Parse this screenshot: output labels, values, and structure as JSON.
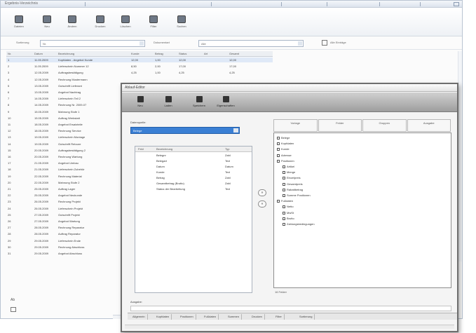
{
  "main": {
    "title": "Ergebnis-Verzeichnis",
    "toolbar": [
      {
        "label": "Dateien",
        "icon": "folder-icon"
      },
      {
        "label": "Neu",
        "icon": "new-icon"
      },
      {
        "label": "Ändern",
        "icon": "edit-icon"
      },
      {
        "label": "Drucken",
        "icon": "print-icon"
      },
      {
        "label": "Löschen",
        "icon": "delete-icon"
      },
      {
        "label": "Filter",
        "icon": "filter-icon"
      },
      {
        "label": "Suchen",
        "icon": "search-icon"
      }
    ],
    "filters": {
      "combo1_label": "Sortierung",
      "combo1_value": "Nr.",
      "combo2_label": "Dokumentart",
      "combo2_value": "Alle",
      "extra_label": "Alle Einträge"
    },
    "columns": [
      "Nr.",
      "Datum",
      "Bezeichnung",
      "Kunde",
      "Betrag",
      "Status",
      "Art",
      "Gesamt"
    ],
    "rows": [
      {
        "nr": "1",
        "date": "11.05.2009",
        "name": "Kopfdaten - Angebot Kunde",
        "v1": "12,00",
        "v2": "1,00",
        "v3": "12,00",
        "v4": "",
        "total": "12,00"
      },
      {
        "nr": "2",
        "date": "11.05.2009",
        "name": "Lieferschein Nummer 12",
        "v1": "8,50",
        "v2": "2,00",
        "v3": "17,00",
        "v4": "",
        "total": "17,00"
      },
      {
        "nr": "3",
        "date": "12.05.2009",
        "name": "Auftragsbestätigung",
        "v1": "4,25",
        "v2": "1,00",
        "v3": "4,25",
        "v4": "",
        "total": "4,25"
      },
      {
        "nr": "4",
        "date": "12.05.2009",
        "name": "Rechnung Mustermann",
        "v1": "",
        "v2": "",
        "v3": "",
        "v4": "",
        "total": ""
      },
      {
        "nr": "5",
        "date": "13.05.2009",
        "name": "Gutschrift Lieferant",
        "v1": "",
        "v2": "",
        "v3": "",
        "v4": "",
        "total": ""
      },
      {
        "nr": "6",
        "date": "13.05.2009",
        "name": "Angebot Nachtrag",
        "v1": "",
        "v2": "",
        "v3": "",
        "v4": "",
        "total": ""
      },
      {
        "nr": "7",
        "date": "14.05.2009",
        "name": "Lieferschein Teil 2",
        "v1": "",
        "v2": "",
        "v3": "",
        "v4": "",
        "total": ""
      },
      {
        "nr": "8",
        "date": "14.05.2009",
        "name": "Rechnung Nr. 2009-07",
        "v1": "",
        "v2": "",
        "v3": "",
        "v4": "",
        "total": ""
      },
      {
        "nr": "9",
        "date": "15.05.2009",
        "name": "Mahnung Stufe 1",
        "v1": "",
        "v2": "",
        "v3": "",
        "v4": "",
        "total": ""
      },
      {
        "nr": "10",
        "date": "15.05.2009",
        "name": "Auftrag Werkstatt",
        "v1": "",
        "v2": "",
        "v3": "",
        "v4": "",
        "total": ""
      },
      {
        "nr": "11",
        "date": "18.05.2009",
        "name": "Angebot Ersatzteile",
        "v1": "",
        "v2": "",
        "v3": "",
        "v4": "",
        "total": ""
      },
      {
        "nr": "12",
        "date": "18.05.2009",
        "name": "Rechnung Service",
        "v1": "",
        "v2": "",
        "v3": "",
        "v4": "",
        "total": ""
      },
      {
        "nr": "13",
        "date": "19.05.2009",
        "name": "Lieferschein Montage",
        "v1": "",
        "v2": "",
        "v3": "",
        "v4": "",
        "total": ""
      },
      {
        "nr": "14",
        "date": "19.05.2009",
        "name": "Gutschrift Retoure",
        "v1": "",
        "v2": "",
        "v3": "",
        "v4": "",
        "total": ""
      },
      {
        "nr": "15",
        "date": "20.05.2009",
        "name": "Auftragsbestätigung 2",
        "v1": "",
        "v2": "",
        "v3": "",
        "v4": "",
        "total": ""
      },
      {
        "nr": "16",
        "date": "20.05.2009",
        "name": "Rechnung Wartung",
        "v1": "",
        "v2": "",
        "v3": "",
        "v4": "",
        "total": ""
      },
      {
        "nr": "17",
        "date": "21.05.2009",
        "name": "Angebot Umbau",
        "v1": "",
        "v2": "",
        "v3": "",
        "v4": "",
        "total": ""
      },
      {
        "nr": "18",
        "date": "21.05.2009",
        "name": "Lieferschein Zubehör",
        "v1": "",
        "v2": "",
        "v3": "",
        "v4": "",
        "total": ""
      },
      {
        "nr": "19",
        "date": "22.05.2009",
        "name": "Rechnung Material",
        "v1": "",
        "v2": "",
        "v3": "",
        "v4": "",
        "total": ""
      },
      {
        "nr": "20",
        "date": "22.05.2009",
        "name": "Mahnung Stufe 2",
        "v1": "",
        "v2": "",
        "v3": "",
        "v4": "",
        "total": ""
      },
      {
        "nr": "21",
        "date": "25.05.2009",
        "name": "Auftrag Lager",
        "v1": "",
        "v2": "",
        "v3": "",
        "v4": "",
        "total": ""
      },
      {
        "nr": "22",
        "date": "25.05.2009",
        "name": "Angebot Neukunde",
        "v1": "",
        "v2": "",
        "v3": "",
        "v4": "",
        "total": ""
      },
      {
        "nr": "23",
        "date": "26.05.2009",
        "name": "Rechnung Projekt",
        "v1": "",
        "v2": "",
        "v3": "",
        "v4": "",
        "total": ""
      },
      {
        "nr": "24",
        "date": "26.05.2009",
        "name": "Lieferschein Projekt",
        "v1": "",
        "v2": "",
        "v3": "",
        "v4": "",
        "total": ""
      },
      {
        "nr": "25",
        "date": "27.05.2009",
        "name": "Gutschrift Projekt",
        "v1": "",
        "v2": "",
        "v3": "",
        "v4": "",
        "total": ""
      },
      {
        "nr": "26",
        "date": "27.05.2009",
        "name": "Angebot Wartung",
        "v1": "",
        "v2": "",
        "v3": "",
        "v4": "",
        "total": ""
      },
      {
        "nr": "27",
        "date": "28.05.2009",
        "name": "Rechnung Reparatur",
        "v1": "",
        "v2": "",
        "v3": "",
        "v4": "",
        "total": ""
      },
      {
        "nr": "28",
        "date": "28.05.2009",
        "name": "Auftrag Reparatur",
        "v1": "",
        "v2": "",
        "v3": "",
        "v4": "",
        "total": ""
      },
      {
        "nr": "29",
        "date": "29.05.2009",
        "name": "Lieferschein Ende",
        "v1": "",
        "v2": "",
        "v3": "",
        "v4": "",
        "total": ""
      },
      {
        "nr": "30",
        "date": "29.05.2009",
        "name": "Rechnung Abschluss",
        "v1": "",
        "v2": "",
        "v3": "",
        "v4": "",
        "total": ""
      },
      {
        "nr": "31",
        "date": "29.05.2009",
        "name": "Angebot Abschluss",
        "v1": "",
        "v2": "",
        "v3": "",
        "v4": "",
        "total": ""
      }
    ],
    "status_text": "Ab"
  },
  "dialog": {
    "title": "Ablauf-Editor",
    "toolbar": [
      {
        "label": "Neu",
        "icon": "new-icon"
      },
      {
        "label": "Laden",
        "icon": "open-icon"
      },
      {
        "label": "Speichern",
        "icon": "save-icon"
      },
      {
        "label": "Eigenschaften",
        "icon": "properties-icon"
      }
    ],
    "source_label": "Datenquelle:",
    "source_value": "Belege",
    "field_columns": [
      "Feld",
      "Bezeichnung",
      "Typ"
    ],
    "fields": [
      {
        "f": "",
        "name": "Belegnr",
        "type": "Zahl"
      },
      {
        "f": "",
        "name": "Belegart",
        "type": "Text"
      },
      {
        "f": "",
        "name": "Datum",
        "type": "Datum"
      },
      {
        "f": "",
        "name": "Kunde",
        "type": "Text"
      },
      {
        "f": "",
        "name": "Betrag",
        "type": "Zahl"
      },
      {
        "f": "",
        "name": "Gesamtbetrag (Brutto)",
        "type": "Zahl"
      },
      {
        "f": "",
        "name": "Status der Bearbeitung",
        "type": "Text"
      }
    ],
    "move_right": "»",
    "move_left": "«",
    "tabs": [
      "Vorlage",
      "Felder",
      "Gruppen",
      "Ausgabe"
    ],
    "tree": [
      {
        "label": "Belege",
        "level": 0
      },
      {
        "label": "Kopfdaten",
        "level": 0
      },
      {
        "label": "Kunde",
        "level": 0
      },
      {
        "label": "Adresse",
        "level": 0
      },
      {
        "label": "Positionen",
        "level": 0
      },
      {
        "label": "Artikel",
        "level": 1
      },
      {
        "label": "Menge",
        "level": 1
      },
      {
        "label": "Einzelpreis",
        "level": 1
      },
      {
        "label": "Gesamtpreis",
        "level": 1
      },
      {
        "label": "Rabattbetrag",
        "level": 1
      },
      {
        "label": "Summe Positionen",
        "level": 1
      },
      {
        "label": "Fußdaten",
        "level": 0
      },
      {
        "label": "Netto",
        "level": 1
      },
      {
        "label": "MwSt",
        "level": 1
      },
      {
        "label": "Brutto",
        "level": 1
      },
      {
        "label": "Zahlungsbedingungen",
        "level": 1
      }
    ],
    "tree_status": "16 Felder",
    "bottom_label": "Ausgabe:",
    "bottom_tabs": [
      "Allgemein",
      "Kopfdaten",
      "Positionen",
      "Fußdaten",
      "Summen",
      "Drucken",
      "Filter",
      "Sortierung"
    ]
  },
  "colors": {
    "accent": "#3a7fd4",
    "dialog_toolbar": "#9e9e9e",
    "window_border": "#b9c4d2"
  }
}
